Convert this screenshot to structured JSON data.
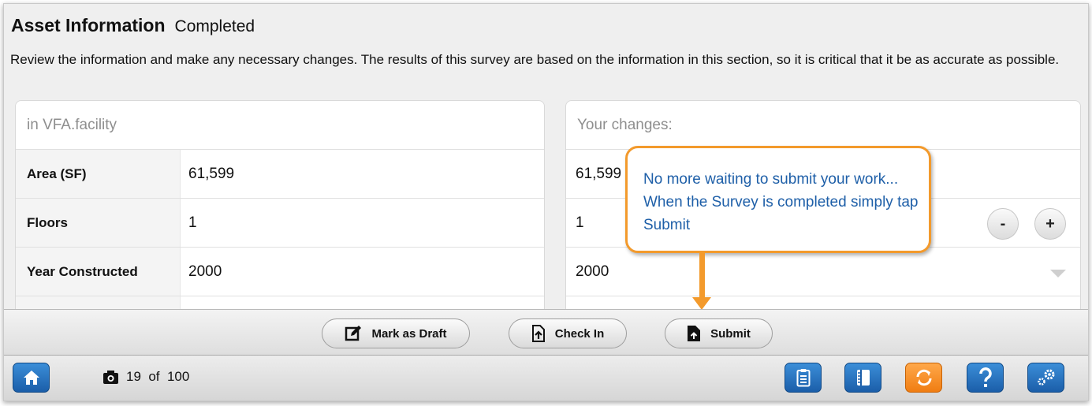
{
  "header": {
    "title": "Asset Information",
    "status": "Completed"
  },
  "description": "Review the information and make any necessary changes. The results of this survey are based on the information in this section, so it is critical that it be as accurate as possible.",
  "left_panel": {
    "heading": "in VFA.facility",
    "rows": [
      {
        "label": "Area (SF)",
        "value": "61,599"
      },
      {
        "label": "Floors",
        "value": "1"
      },
      {
        "label": "Year Constructed",
        "value": "2000"
      }
    ]
  },
  "right_panel": {
    "heading": "Your changes:",
    "rows": [
      {
        "value": "61,599"
      },
      {
        "value": "1"
      },
      {
        "value": "2000"
      }
    ],
    "stepper": {
      "minus": "-",
      "plus": "+"
    }
  },
  "callout": {
    "text": "No more waiting to submit your work... When the Survey is completed simply tap Submit"
  },
  "actions": {
    "draft": "Mark as Draft",
    "checkin": "Check In",
    "submit": "Submit"
  },
  "footer": {
    "photo_count": "19  of  100"
  },
  "colors": {
    "accent_blue": "#1f66b3",
    "accent_orange": "#f39a2c",
    "callout_text": "#1e5fa8"
  }
}
